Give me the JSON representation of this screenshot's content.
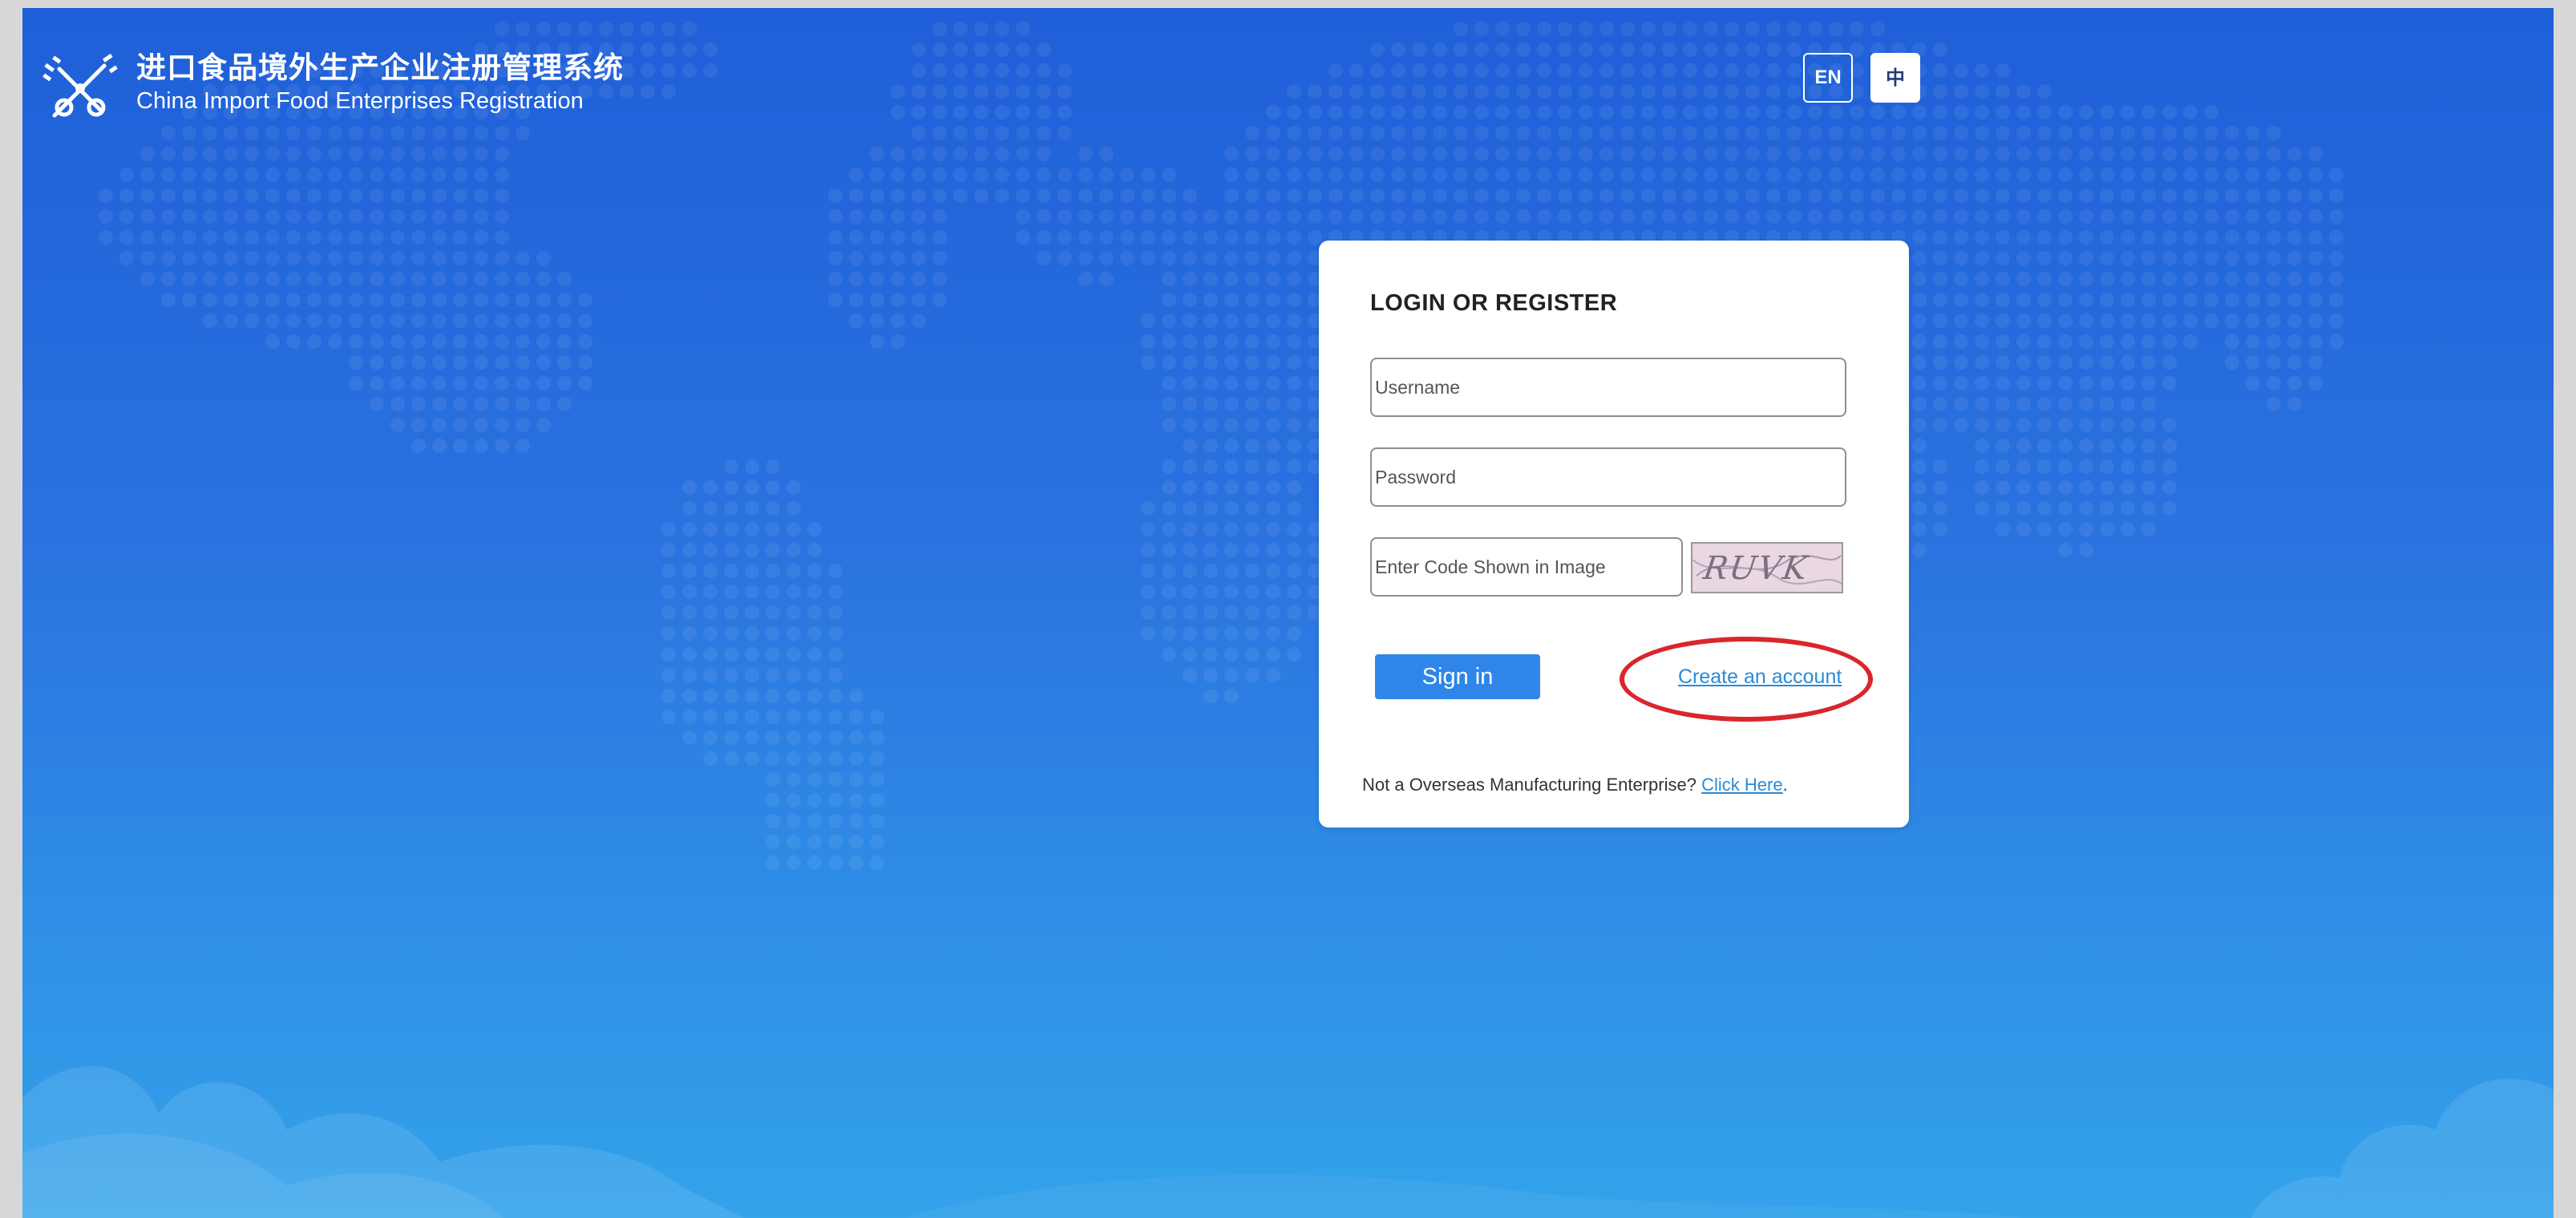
{
  "header": {
    "title_cn": "进口食品境外生产企业注册管理系统",
    "title_en": "China Import Food Enterprises Registration",
    "logo_icon": "satellite-logo-icon"
  },
  "language": {
    "en_label": "EN",
    "cn_label": "中",
    "selected": "EN"
  },
  "login": {
    "title": "LOGIN OR REGISTER",
    "username_placeholder": "Username",
    "password_placeholder": "Password",
    "captcha_placeholder": "Enter Code Shown in Image",
    "captcha_text": "RUVK",
    "signin_label": "Sign in",
    "create_account_label": "Create an account",
    "notice_text": "Not a Overseas Manufacturing Enterprise?",
    "notice_link": "Click Here",
    "notice_end": "."
  },
  "colors": {
    "background_top": "#1f5fd8",
    "background_bottom": "#33a3ea",
    "button": "#2f86e8",
    "link": "#2a8bd6",
    "annotation": "#d9262c"
  }
}
